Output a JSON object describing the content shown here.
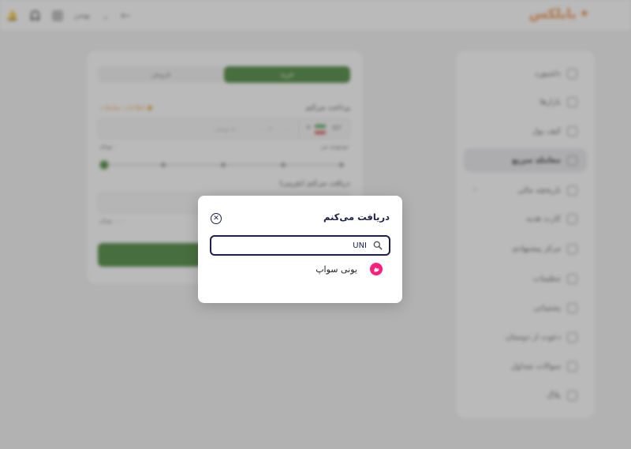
{
  "header": {
    "logo": "بابلکس",
    "user_name": "بهمن"
  },
  "sidebar": {
    "items": [
      {
        "label": "داشبورد",
        "icon": "dashboard-icon"
      },
      {
        "label": "بازارها",
        "icon": "chart-icon"
      },
      {
        "label": "کیف پول",
        "icon": "wallet-icon"
      },
      {
        "label": "معامله سریع",
        "icon": "swap-icon",
        "active": true
      },
      {
        "label": "تاریخچه مالی",
        "icon": "history-icon"
      },
      {
        "label": "کارت هدیه",
        "icon": "gift-icon"
      },
      {
        "label": "مرکز پیشنهادی",
        "icon": "offer-icon"
      },
      {
        "label": "تنظیمات",
        "icon": "settings-icon"
      },
      {
        "label": "پشتیبانی",
        "icon": "support-icon"
      },
      {
        "label": "دعوت از دوستان",
        "icon": "invite-icon"
      },
      {
        "label": "سوالات متداول",
        "icon": "faq-icon"
      },
      {
        "label": "بلاگ",
        "icon": "blog-icon"
      }
    ]
  },
  "trade": {
    "tab_buy": "خرید",
    "tab_sell": "فروش",
    "pay_label": "پرداخت می‌کنم",
    "pay_hint": "اطلاعات معاملات",
    "pay_currency": "IRT",
    "pay_placeholder": "۳۰۰,۰۰۰ - ۵۰,۰۰۰,۰۰۰ تومان",
    "range_label": "موجودی من",
    "range_value": "۰ تومان",
    "receive_label": "دریافت می‌کنم (تقریبی)",
    "receive_value": "۰.۰۰ تومان"
  },
  "modal": {
    "title": "دریافت می‌کنم",
    "search_value": "UNI",
    "results": [
      {
        "name": "یونی سواپ",
        "icon": "uniswap-icon",
        "color": "#ff1f7a"
      }
    ]
  },
  "colors": {
    "accent_green": "#3a7c2a",
    "modal_text": "#1c1f4a",
    "brand_orange": "#f08a3c"
  }
}
